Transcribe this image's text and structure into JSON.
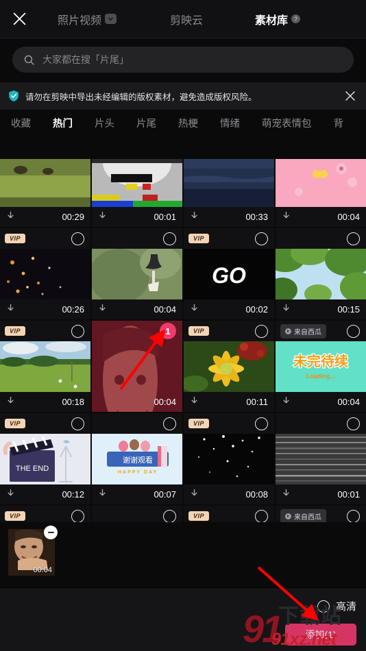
{
  "header": {
    "close_icon": "close-icon",
    "tabs": [
      {
        "label": "照片视频",
        "active": false,
        "chevron": "chevron-down-icon"
      },
      {
        "label": "剪映云",
        "active": false
      },
      {
        "label": "素材库",
        "active": true,
        "help": "?"
      }
    ]
  },
  "search": {
    "icon": "search-icon",
    "placeholder": "大家都在搜「片尾」"
  },
  "notice": {
    "icon": "shield-check-icon",
    "text": "请勿在剪映中导出未经编辑的版权素材，避免造成版权风险。",
    "close_icon": "close-icon"
  },
  "category_tabs": [
    {
      "label": "收藏",
      "active": false
    },
    {
      "label": "热门",
      "active": true
    },
    {
      "label": "片头",
      "active": false
    },
    {
      "label": "片尾",
      "active": false
    },
    {
      "label": "热梗",
      "active": false
    },
    {
      "label": "情绪",
      "active": false
    },
    {
      "label": "萌宠表情包",
      "active": false
    },
    {
      "label": "背",
      "active": false
    }
  ],
  "grid": {
    "rows": [
      {
        "partial_top": true,
        "cards": [
          {
            "duration": "00:29",
            "vip": false,
            "source": null,
            "selected": false,
            "art": "forest"
          },
          {
            "duration": "00:01",
            "vip": false,
            "source": null,
            "selected": false,
            "art": "testpattern"
          },
          {
            "duration": "00:33",
            "vip": false,
            "source": null,
            "selected": false,
            "art": "ocean"
          },
          {
            "duration": "00:04",
            "vip": false,
            "source": null,
            "selected": false,
            "art": "pinkflower"
          }
        ]
      },
      {
        "cards": [
          {
            "duration": "00:26",
            "vip": true,
            "vip_label": "VIP",
            "source": null,
            "selected": false,
            "art": "sparks"
          },
          {
            "duration": "00:04",
            "vip": false,
            "source": null,
            "selected": false,
            "art": "bell"
          },
          {
            "duration": "00:02",
            "vip": true,
            "vip_label": "VIP",
            "source": null,
            "selected": false,
            "art": "go"
          },
          {
            "duration": "00:15",
            "vip": false,
            "source": null,
            "selected": false,
            "art": "canopy"
          }
        ]
      },
      {
        "cards": [
          {
            "duration": "00:18",
            "vip": true,
            "vip_label": "VIP",
            "source": null,
            "selected": false,
            "art": "meadow"
          },
          {
            "duration": "00:04",
            "vip": false,
            "source": null,
            "selected": true,
            "badge": "1",
            "art": "manface"
          },
          {
            "duration": "00:11",
            "vip": true,
            "vip_label": "VIP",
            "source": null,
            "selected": false,
            "art": "yellowflower"
          },
          {
            "duration": "00:04",
            "vip": false,
            "source": "来自西瓜",
            "selected": false,
            "art": "tobecontinued"
          }
        ]
      },
      {
        "cards": [
          {
            "duration": "00:12",
            "vip": true,
            "vip_label": "VIP",
            "source": null,
            "selected": false,
            "art": "theend"
          },
          {
            "duration": "00:07",
            "vip": false,
            "source": null,
            "selected": false,
            "art": "happyday"
          },
          {
            "duration": "00:08",
            "vip": true,
            "vip_label": "VIP",
            "source": null,
            "selected": false,
            "art": "snow"
          },
          {
            "duration": "00:01",
            "vip": false,
            "source": null,
            "selected": false,
            "art": "noise"
          }
        ]
      },
      {
        "partial_bottom": true,
        "cards": [
          {
            "duration": "",
            "vip": true,
            "vip_label": "VIP",
            "source": null,
            "selected": false,
            "art": "sunset"
          },
          {
            "duration": "",
            "vip": false,
            "source": null,
            "selected": false,
            "art": "colorbars"
          },
          {
            "duration": "",
            "vip": true,
            "vip_label": "VIP",
            "source": null,
            "selected": false,
            "art": "citynight"
          },
          {
            "duration": "",
            "vip": false,
            "source": "来自西瓜",
            "selected": false,
            "art": "birds"
          }
        ]
      }
    ]
  },
  "tray": {
    "items": [
      {
        "duration": "00:04",
        "remove_icon": "minus-circle-icon",
        "art": "manface"
      }
    ]
  },
  "bottom_bar": {
    "hd_label": "高清",
    "hd_selected": false,
    "add_label": "添加(1)"
  },
  "watermark": {
    "nine": "91",
    "cn": "下载站",
    "net": "91xz.net"
  },
  "colors": {
    "accent": "#f03a6e",
    "vip_badge": "#f4d4b4",
    "background": "#0a0a0a",
    "panel": "#151518",
    "selected_overlay": "#961632",
    "arrow": "#ff0000"
  }
}
